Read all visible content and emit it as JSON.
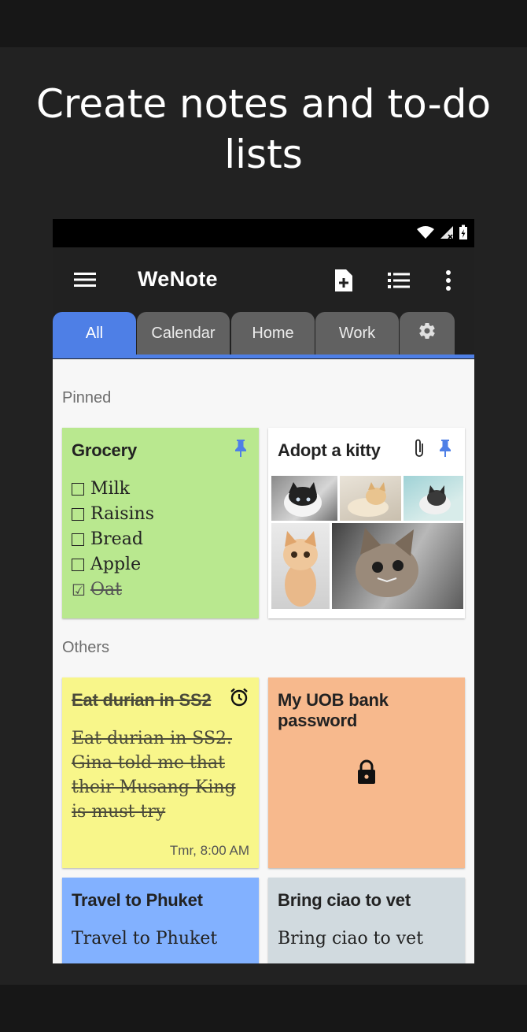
{
  "headline": {
    "line1": "Create notes and to-do",
    "line2": "lists"
  },
  "appbar": {
    "title": "WeNote",
    "menu_icon": "hamburger-menu-icon",
    "actions": [
      "new-note-icon",
      "checklist-icon",
      "more-vert-icon"
    ]
  },
  "tabs": [
    {
      "label": "All",
      "active": true
    },
    {
      "label": "Calendar",
      "active": false
    },
    {
      "label": "Home",
      "active": false
    },
    {
      "label": "Work",
      "active": false
    },
    {
      "label": "",
      "icon": "settings-gear-icon",
      "active": false
    }
  ],
  "sections": {
    "pinned": "Pinned",
    "others": "Others"
  },
  "notes": {
    "grocery": {
      "title": "Grocery",
      "color": "#b9e88f",
      "pinned": true,
      "items": [
        {
          "text": "Milk",
          "checked": false
        },
        {
          "text": "Raisins",
          "checked": false
        },
        {
          "text": "Bread",
          "checked": false
        },
        {
          "text": "Apple",
          "checked": false
        },
        {
          "text": "Oat",
          "checked": true
        }
      ]
    },
    "kitty": {
      "title": "Adopt a kitty",
      "color": "#ffffff",
      "pinned": true,
      "attachment": true
    },
    "durian": {
      "title": "Eat durian in SS2",
      "color": "#f8f68a",
      "body_lines": [
        "Eat durian in SS2.",
        "Gina told me that",
        "their Musang King",
        "is must try"
      ],
      "reminder": "Tmr, 8:00 AM",
      "struck": true
    },
    "uob": {
      "title": "My UOB bank password",
      "color": "#f7b98d",
      "locked": true
    },
    "phuket": {
      "title": "Travel to Phuket",
      "body": "Travel to Phuket",
      "color": "#82b1ff"
    },
    "vet": {
      "title": "Bring ciao to vet",
      "body": "Bring ciao to vet",
      "color": "#d1dadf"
    }
  }
}
